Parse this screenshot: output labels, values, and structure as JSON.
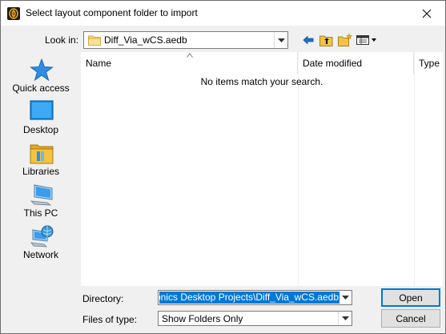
{
  "window": {
    "title": "Select layout component folder to import",
    "close_glyph": "✕"
  },
  "lookin": {
    "label": "Look in:",
    "value": "Diff_Via_wCS.aedb"
  },
  "toolbar": {
    "icons": [
      "back-arrow-icon",
      "up-folder-icon",
      "new-folder-icon",
      "view-menu-icon"
    ]
  },
  "places": [
    {
      "label": "Quick access",
      "icon": "quick-access-star-icon"
    },
    {
      "label": "Desktop",
      "icon": "desktop-icon"
    },
    {
      "label": "Libraries",
      "icon": "libraries-icon"
    },
    {
      "label": "This PC",
      "icon": "this-pc-icon"
    },
    {
      "label": "Network",
      "icon": "network-icon"
    }
  ],
  "filelist": {
    "columns": [
      "Name",
      "Date modified",
      "Type"
    ],
    "empty_message": "No items match your search."
  },
  "directory": {
    "label": "Directory:",
    "value": "Electronics Desktop Projects\\Diff_Via_wCS.aedb"
  },
  "filetype": {
    "label": "Files of type:",
    "value": "Show Folders Only"
  },
  "buttons": {
    "open": "Open",
    "cancel": "Cancel"
  },
  "colors": {
    "selection": "#0078d7",
    "folder": "#f5c342",
    "accent": "#1e6fcf"
  }
}
